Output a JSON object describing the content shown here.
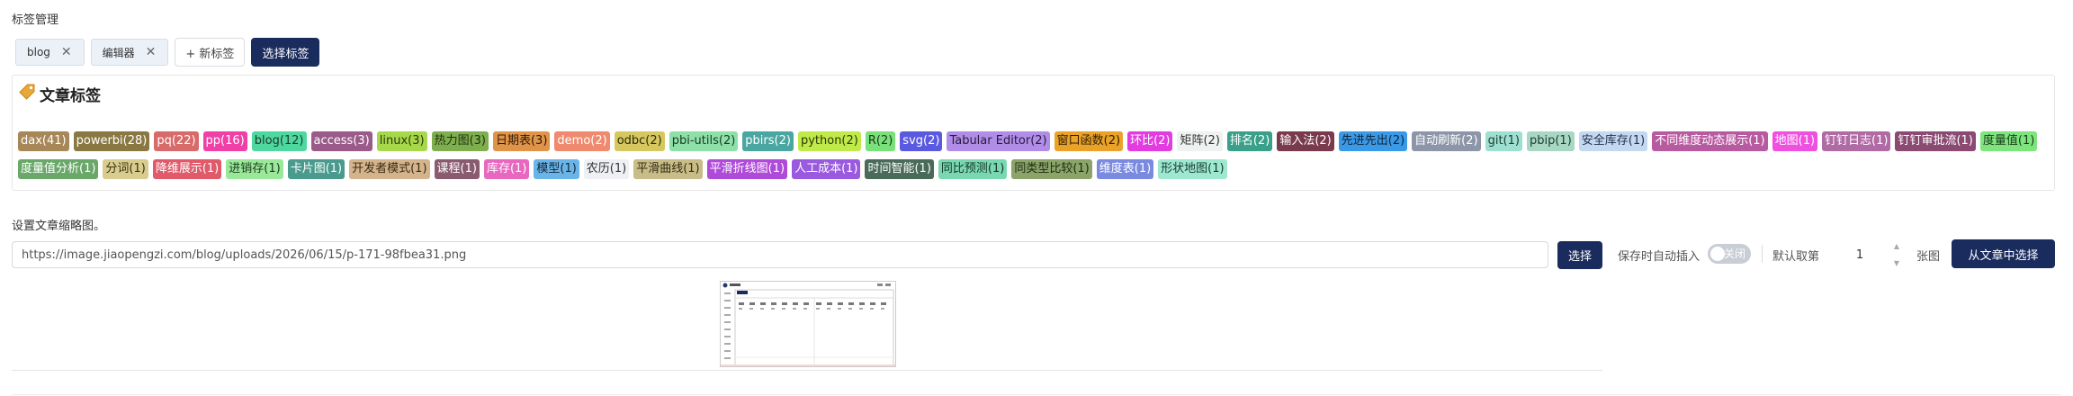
{
  "section_title": "标签管理",
  "selected_tags": [
    {
      "label": "blog"
    },
    {
      "label": "编辑器"
    }
  ],
  "new_tag_label": "+ 新标签",
  "choose_tags_label": "选择标签",
  "panel_title": "文章标签",
  "tags": [
    {
      "label": "dax(41)",
      "bg": "#a78758",
      "fg": "#ffffff"
    },
    {
      "label": "powerbi(28)",
      "bg": "#8a7842",
      "fg": "#ffffff"
    },
    {
      "label": "pq(22)",
      "bg": "#d86a6a",
      "fg": "#ffffff"
    },
    {
      "label": "pp(16)",
      "bg": "#f040a8",
      "fg": "#ffffff"
    },
    {
      "label": "blog(12)",
      "bg": "#4ed8a0",
      "fg": "#1d3a2d"
    },
    {
      "label": "access(3)",
      "bg": "#9a5a8a",
      "fg": "#ffffff"
    },
    {
      "label": "linux(3)",
      "bg": "#a6d84a",
      "fg": "#2a3a10"
    },
    {
      "label": "热力图(3)",
      "bg": "#7fae4e",
      "fg": "#1e2e10"
    },
    {
      "label": "日期表(3)",
      "bg": "#e0944a",
      "fg": "#2e1a08"
    },
    {
      "label": "demo(2)",
      "bg": "#f08a6e",
      "fg": "#ffffff"
    },
    {
      "label": "odbc(2)",
      "bg": "#d6c860",
      "fg": "#2e2a08"
    },
    {
      "label": "pbi-utils(2)",
      "bg": "#8ee0a8",
      "fg": "#1a3a22"
    },
    {
      "label": "pbirs(2)",
      "bg": "#4aa6a0",
      "fg": "#ffffff"
    },
    {
      "label": "python(2)",
      "bg": "#c0ea4a",
      "fg": "#2a3a08"
    },
    {
      "label": "R(2)",
      "bg": "#7ae07a",
      "fg": "#1a3a1a"
    },
    {
      "label": "svg(2)",
      "bg": "#5a5ae0",
      "fg": "#ffffff"
    },
    {
      "label": "Tabular Editor(2)",
      "bg": "#b08ee8",
      "fg": "#2a1a3e"
    },
    {
      "label": "窗口函数(2)",
      "bg": "#eaa228",
      "fg": "#2e1e04"
    },
    {
      "label": "环比(2)",
      "bg": "#e23ce0",
      "fg": "#ffffff"
    },
    {
      "label": "矩阵(2)",
      "bg": "#eef2f0",
      "fg": "#333333"
    },
    {
      "label": "排名(2)",
      "bg": "#3aa08a",
      "fg": "#ffffff"
    },
    {
      "label": "输入法(2)",
      "bg": "#7a3a4e",
      "fg": "#ffffff"
    },
    {
      "label": "先进先出(2)",
      "bg": "#3a9ae8",
      "fg": "#10243a"
    },
    {
      "label": "自动刷新(2)",
      "bg": "#8c96a8",
      "fg": "#ffffff"
    },
    {
      "label": "git(1)",
      "bg": "#9ee0d0",
      "fg": "#1e3a34"
    },
    {
      "label": "pbip(1)",
      "bg": "#a8d8c4",
      "fg": "#1e3a30"
    },
    {
      "label": "安全库存(1)",
      "bg": "#c4d8f0",
      "fg": "#22324a"
    },
    {
      "label": "不同维度动态展示(1)",
      "bg": "#b85aa0",
      "fg": "#ffffff"
    },
    {
      "label": "地图(1)",
      "bg": "#f050e0",
      "fg": "#ffffff"
    },
    {
      "label": "钉钉日志(1)",
      "bg": "#b06aa4",
      "fg": "#ffffff"
    },
    {
      "label": "钉钉审批流(1)",
      "bg": "#8a4a72",
      "fg": "#ffffff"
    },
    {
      "label": "度量值(1)",
      "bg": "#7ee47e",
      "fg": "#1a3a1a"
    },
    {
      "label": "度量值分析(1)",
      "bg": "#6aa86a",
      "fg": "#ffffff"
    },
    {
      "label": "分词(1)",
      "bg": "#d8cc8e",
      "fg": "#3a3214"
    },
    {
      "label": "降维展示(1)",
      "bg": "#e05a6a",
      "fg": "#ffffff"
    },
    {
      "label": "进销存(1)",
      "bg": "#9ae89a",
      "fg": "#1a3a1a"
    },
    {
      "label": "卡片图(1)",
      "bg": "#4a9a8e",
      "fg": "#ffffff"
    },
    {
      "label": "开发者模式(1)",
      "bg": "#d4b48c",
      "fg": "#3a2a14"
    },
    {
      "label": "课程(1)",
      "bg": "#8a5a6e",
      "fg": "#ffffff"
    },
    {
      "label": "库存(1)",
      "bg": "#e868c0",
      "fg": "#ffffff"
    },
    {
      "label": "模型(1)",
      "bg": "#6ab4e8",
      "fg": "#14283a"
    },
    {
      "label": "农历(1)",
      "bg": "#eef0f4",
      "fg": "#333333"
    },
    {
      "label": "平滑曲线(1)",
      "bg": "#c8bc88",
      "fg": "#332e14"
    },
    {
      "label": "平滑折线图(1)",
      "bg": "#b04ad8",
      "fg": "#ffffff"
    },
    {
      "label": "人工成本(1)",
      "bg": "#9a5ae0",
      "fg": "#ffffff"
    },
    {
      "label": "时间智能(1)",
      "bg": "#4a6a5a",
      "fg": "#ffffff"
    },
    {
      "label": "同比预测(1)",
      "bg": "#7ad8b0",
      "fg": "#16362a"
    },
    {
      "label": "同类型比较(1)",
      "bg": "#8aa46a",
      "fg": "#1e2a10"
    },
    {
      "label": "维度表(1)",
      "bg": "#7a8ae0",
      "fg": "#ffffff"
    },
    {
      "label": "形状地图(1)",
      "bg": "#9ee8d0",
      "fg": "#163a30"
    }
  ],
  "thumbnail_label": "设置文章缩略图。",
  "thumbnail_url": "https://image.jiaopengzi.com/blog/uploads/2026/06/15/p-171-98fbea31.png",
  "select_button": "选择",
  "auto_insert_label": "保存时自动插入",
  "toggle_text": "关闭",
  "default_pick_label": "默认取第",
  "default_pick_value": "1",
  "unit_label": "张图",
  "from_article_button": "从文章中选择"
}
